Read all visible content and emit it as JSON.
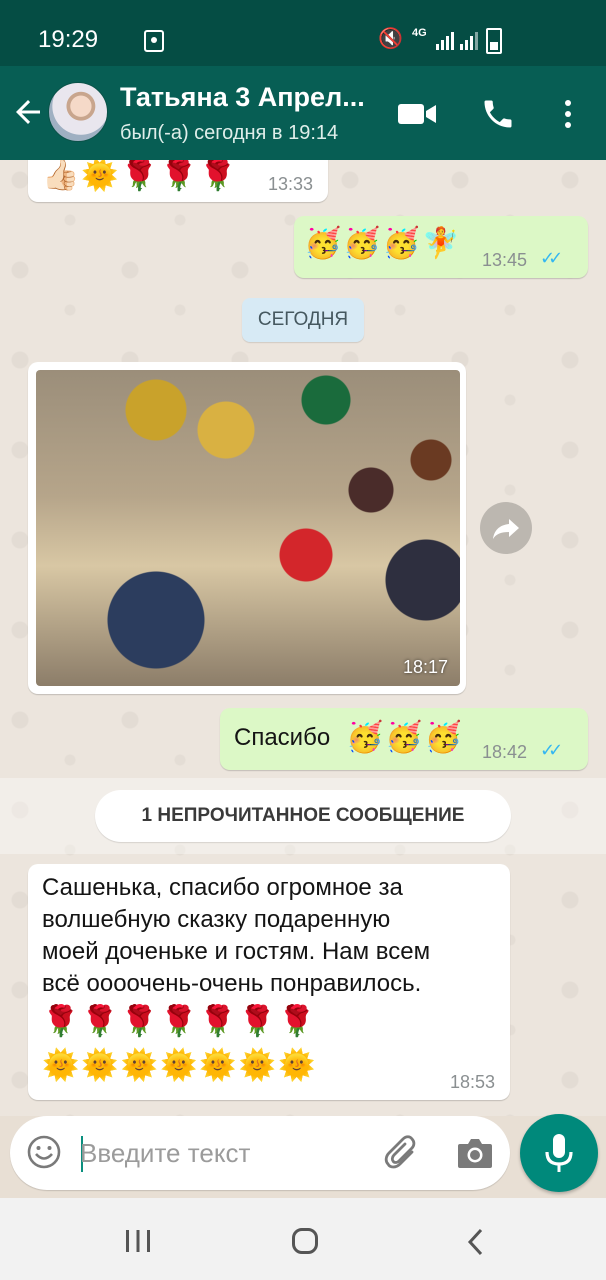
{
  "status_bar": {
    "time": "19:29",
    "network": "4G"
  },
  "header": {
    "contact_name": "Татьяна 3 Апрел...",
    "last_seen": "был(-а) сегодня в 19:14"
  },
  "chat": {
    "messages": [
      {
        "direction": "in",
        "emoji": "👍🏻🌞🌹🌹🌹",
        "time": "13:33"
      },
      {
        "direction": "out",
        "emoji": "🥳🥳🥳🧚",
        "time": "13:45",
        "status": "read"
      },
      {
        "type": "date",
        "label": "СЕГОДНЯ"
      },
      {
        "direction": "in",
        "type": "photo",
        "time": "18:17"
      },
      {
        "direction": "out",
        "text": "Спасибо",
        "emoji": "🥳🥳🥳",
        "time": "18:42",
        "status": "read"
      },
      {
        "type": "unread",
        "label": "1 НЕПРОЧИТАННОЕ СООБЩЕНИЕ"
      },
      {
        "direction": "in",
        "lines": [
          "Сашенька, спасибо огромное за",
          "волшебную сказку подаренную",
          "моей доченьке и гостям. Нам всем",
          "всё оооочень-очень понравилось."
        ],
        "emoji_line1": "🌹🌹🌹🌹🌹🌹🌹",
        "emoji_line2": "🌞🌞🌞🌞🌞🌞🌞",
        "time": "18:53"
      }
    ]
  },
  "input": {
    "placeholder": "Введите текст"
  },
  "colors": {
    "header": "#075e54",
    "accent": "#00897b",
    "outgoing_bubble": "#dcf8c6",
    "read_ticks": "#34b7f1"
  },
  "icons": [
    "back-arrow-icon",
    "video-call-icon",
    "phone-icon",
    "more-vert-icon",
    "forward-icon",
    "emoji-icon",
    "attach-icon",
    "camera-icon",
    "mic-icon"
  ]
}
